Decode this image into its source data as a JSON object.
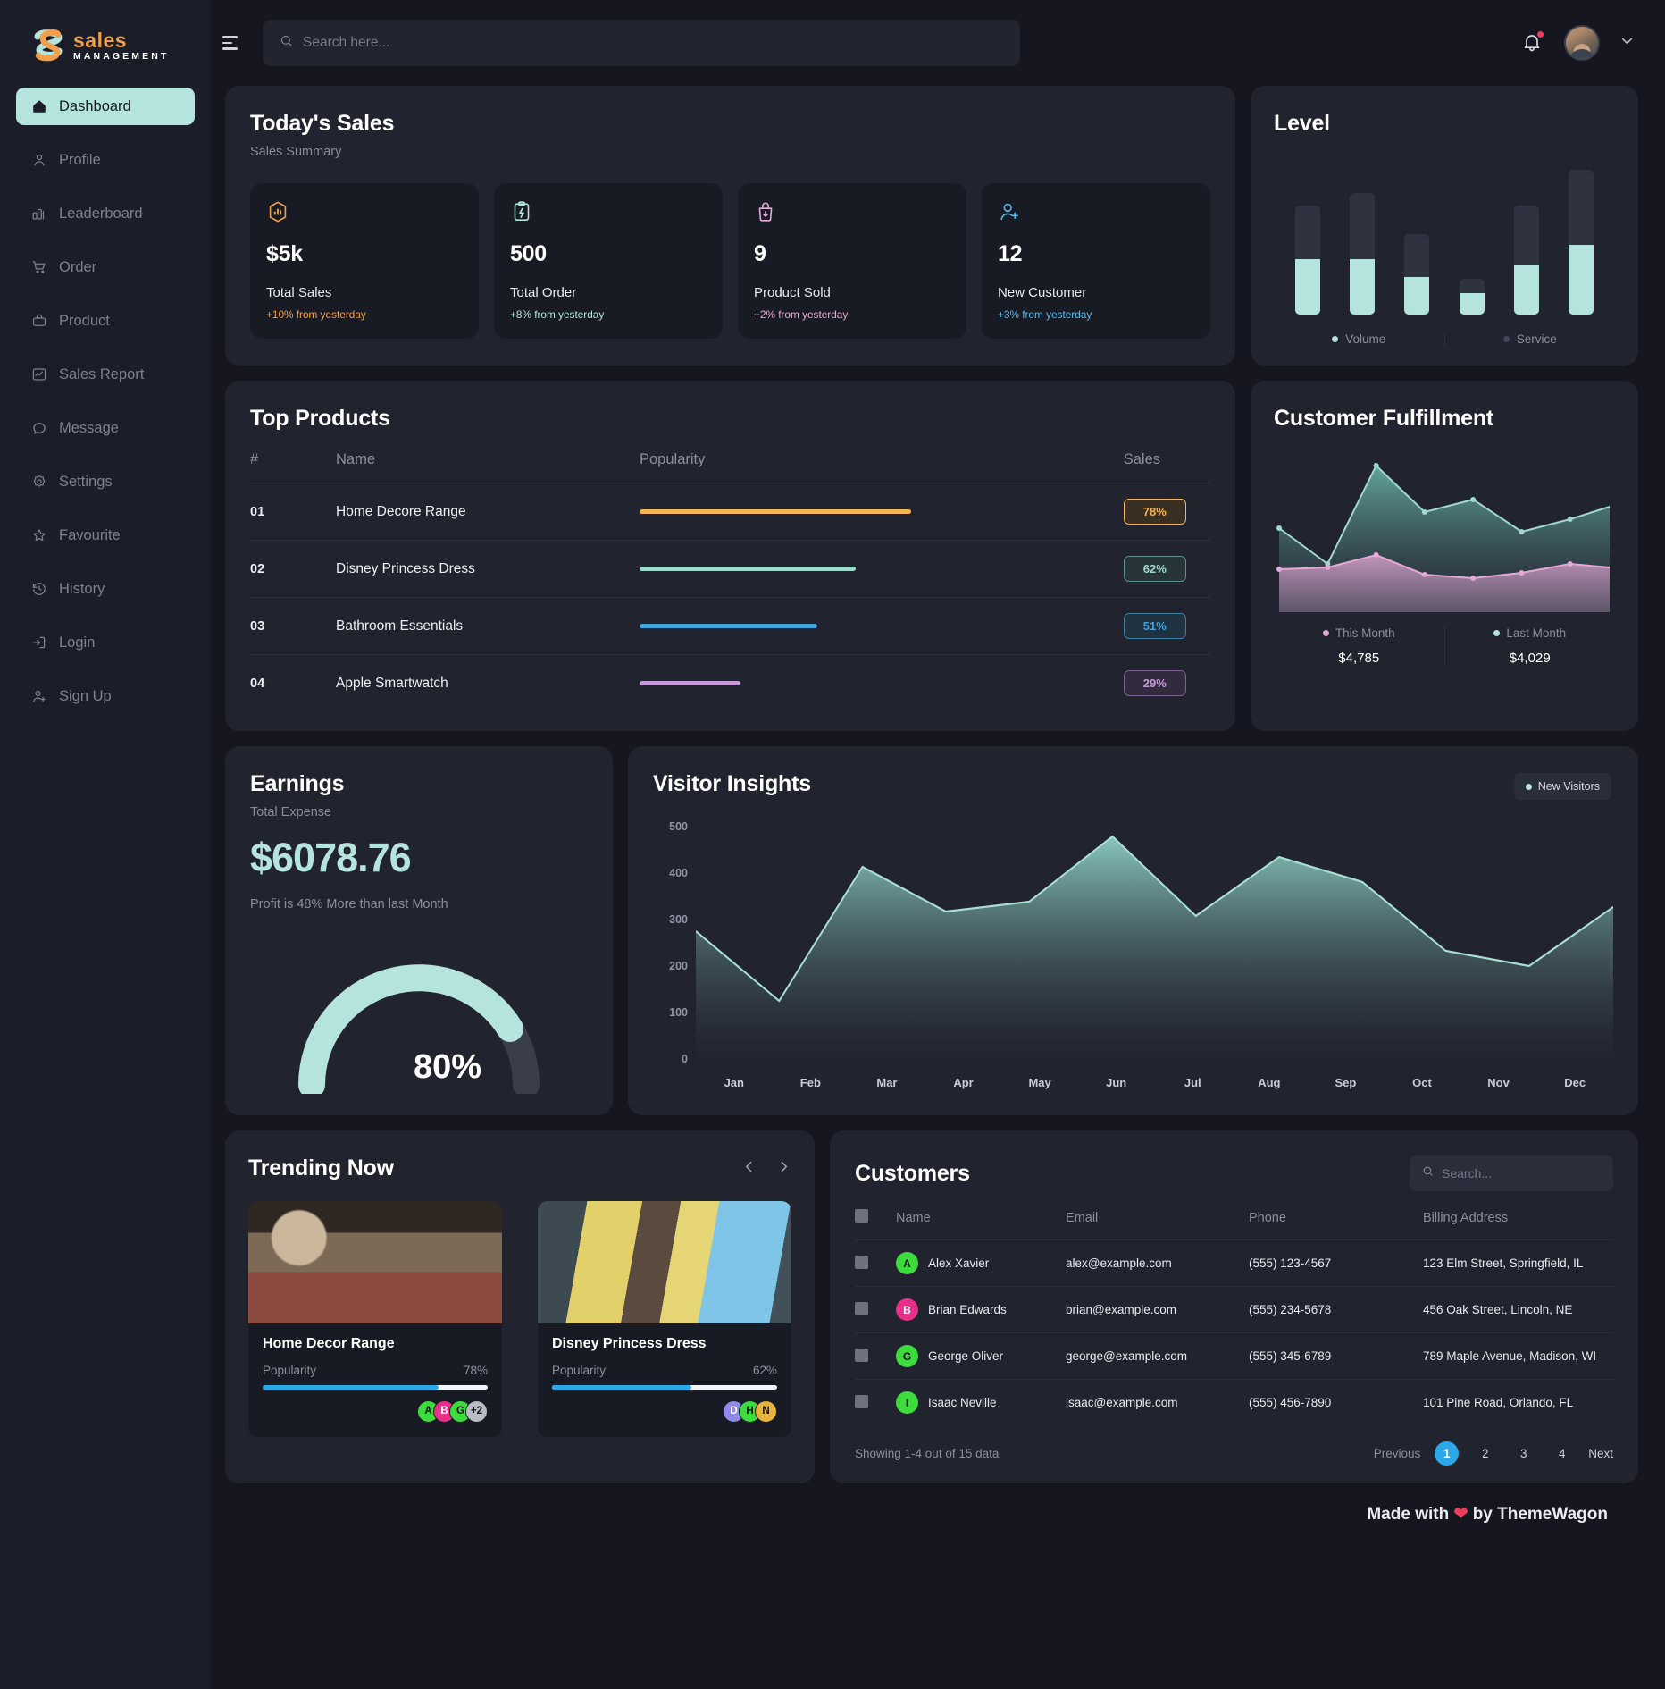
{
  "brand": {
    "line1": "sales",
    "line2": "MANAGEMENT"
  },
  "sidebar": {
    "items": [
      {
        "label": "Dashboard",
        "icon": "home-icon",
        "active": true
      },
      {
        "label": "Profile",
        "icon": "user-icon",
        "active": false
      },
      {
        "label": "Leaderboard",
        "icon": "bar-chart-icon",
        "active": false
      },
      {
        "label": "Order",
        "icon": "cart-icon",
        "active": false
      },
      {
        "label": "Product",
        "icon": "bag-icon",
        "active": false
      },
      {
        "label": "Sales Report",
        "icon": "line-chart-icon",
        "active": false
      },
      {
        "label": "Message",
        "icon": "chat-icon",
        "active": false
      },
      {
        "label": "Settings",
        "icon": "gear-icon",
        "active": false
      },
      {
        "label": "Favourite",
        "icon": "star-icon",
        "active": false
      },
      {
        "label": "History",
        "icon": "history-icon",
        "active": false
      },
      {
        "label": "Login",
        "icon": "login-icon",
        "active": false
      },
      {
        "label": "Sign Up",
        "icon": "user-plus-icon",
        "active": false
      }
    ]
  },
  "topbar": {
    "search_placeholder": "Search here...",
    "notification_badge": true
  },
  "todays_sales": {
    "title": "Today's Sales",
    "subtitle": "Sales Summary",
    "stats": [
      {
        "value": "$5k",
        "label": "Total Sales",
        "change": "+10% from yesterday",
        "color": "#f0a04b",
        "icon": "chart-hexagon-icon"
      },
      {
        "value": "500",
        "label": "Total Order",
        "change": "+8% from yesterday",
        "color": "#b5e3dd",
        "icon": "clipboard-bolt-icon"
      },
      {
        "value": "9",
        "label": "Product Sold",
        "change": "+2% from yesterday",
        "color": "#e6a8d6",
        "icon": "bag-down-icon"
      },
      {
        "value": "12",
        "label": "New Customer",
        "change": "+3% from yesterday",
        "color": "#5ab9e8",
        "icon": "user-add-icon"
      }
    ]
  },
  "level": {
    "title": "Level",
    "legend": [
      {
        "label": "Volume",
        "color": "#b5e3dd"
      },
      {
        "label": "Service",
        "color": "#2f3340"
      }
    ],
    "chart_data": {
      "type": "bar",
      "title": "Level",
      "categories": [
        "1",
        "2",
        "3",
        "4",
        "5",
        "6"
      ],
      "series": [
        {
          "name": "Service",
          "values": [
            60,
            74,
            48,
            16,
            66,
            84
          ]
        },
        {
          "name": "Volume",
          "values": [
            62,
            62,
            42,
            24,
            56,
            78
          ]
        }
      ],
      "ylim": [
        0,
        150
      ],
      "grid": false,
      "legend_position": "bottom"
    }
  },
  "top_products": {
    "title": "Top Products",
    "columns": [
      "#",
      "Name",
      "Popularity",
      "Sales"
    ],
    "rows": [
      {
        "num": "01",
        "name": "Home Decore Range",
        "popularity": 78,
        "sales": "78%",
        "color": "#f5b553"
      },
      {
        "num": "02",
        "name": "Disney Princess Dress",
        "popularity": 62,
        "sales": "62%",
        "color": "#9fd8cd"
      },
      {
        "num": "03",
        "name": "Bathroom Essentials",
        "popularity": 51,
        "sales": "51%",
        "color": "#3ea5e0"
      },
      {
        "num": "04",
        "name": "Apple Smartwatch",
        "popularity": 29,
        "sales": "29%",
        "color": "#c39ad6"
      }
    ]
  },
  "customer_fulfillment": {
    "title": "Customer Fulfillment",
    "footer": [
      {
        "label": "This Month",
        "value": "$4,785",
        "color": "#e6a8d6"
      },
      {
        "label": "Last Month",
        "value": "$4,029",
        "color": "#b5e3dd"
      }
    ],
    "chart_data": {
      "type": "area",
      "title": "Customer Fulfillment",
      "x": [
        "1",
        "2",
        "3",
        "4",
        "5",
        "6",
        "7",
        "8"
      ],
      "series": [
        {
          "name": "Last Month",
          "color": "#b5e3dd",
          "values": [
            52,
            30,
            95,
            60,
            70,
            48,
            58,
            62
          ]
        },
        {
          "name": "This Month",
          "color": "#e6a8d6",
          "values": [
            22,
            24,
            36,
            20,
            18,
            22,
            26,
            24
          ]
        }
      ],
      "grid": false,
      "legend_position": "bottom"
    }
  },
  "earnings": {
    "title": "Earnings",
    "subtitle": "Total Expense",
    "amount": "$6078.76",
    "note": "Profit is 48% More than last Month",
    "gauge_percent": "80%",
    "chart_data": {
      "type": "pie",
      "title": "Earnings gauge",
      "categories": [
        "Achieved",
        "Remaining"
      ],
      "values": [
        80,
        20
      ],
      "ylabel": "%"
    }
  },
  "visitor_insights": {
    "title": "Visitor Insights",
    "legend_label": "New Visitors",
    "chart_data": {
      "type": "area",
      "title": "Visitor Insights",
      "xlabel": "",
      "ylabel": "",
      "categories": [
        "Jan",
        "Feb",
        "Mar",
        "Apr",
        "May",
        "Jun",
        "Jul",
        "Aug",
        "Sep",
        "Oct",
        "Nov",
        "Dec"
      ],
      "values": [
        270,
        130,
        400,
        310,
        330,
        480,
        300,
        420,
        370,
        230,
        200,
        320
      ],
      "ylim": [
        0,
        500
      ],
      "yticks": [
        0,
        100,
        200,
        300,
        400,
        500
      ],
      "grid": false,
      "legend_position": "top-right"
    }
  },
  "trending": {
    "title": "Trending Now",
    "cards": [
      {
        "name": "Home Decor Range",
        "meta_label": "Popularity",
        "percent": "78%",
        "progress": 78,
        "faces": [
          {
            "t": "A",
            "c": "#3ddc3d"
          },
          {
            "t": "B",
            "c": "#e8308a"
          },
          {
            "t": "G",
            "c": "#3ddc3d"
          },
          {
            "t": "+2",
            "c": "#b9bcc4"
          }
        ],
        "image": "living-room-photo"
      },
      {
        "name": "Disney Princess Dress",
        "meta_label": "Popularity",
        "percent": "62%",
        "progress": 62,
        "faces": [
          {
            "t": "D",
            "c": "#8f8ae8"
          },
          {
            "t": "H",
            "c": "#3ddc3d"
          },
          {
            "t": "N",
            "c": "#e8b33d"
          }
        ],
        "image": "princess-dress-photo"
      }
    ]
  },
  "customers": {
    "title": "Customers",
    "search_placeholder": "Search...",
    "columns": [
      "Name",
      "Email",
      "Phone",
      "Billing Address"
    ],
    "rows": [
      {
        "initial": "A",
        "color": "#3ddc3d",
        "name": "Alex Xavier",
        "email": "alex@example.com",
        "phone": "(555) 123-4567",
        "address": "123 Elm Street, Springfield, IL"
      },
      {
        "initial": "B",
        "color": "#e8308a",
        "name": "Brian Edwards",
        "email": "brian@example.com",
        "phone": "(555) 234-5678",
        "address": "456 Oak Street, Lincoln, NE"
      },
      {
        "initial": "G",
        "color": "#3ddc3d",
        "name": "George Oliver",
        "email": "george@example.com",
        "phone": "(555) 345-6789",
        "address": "789 Maple Avenue, Madison, WI"
      },
      {
        "initial": "I",
        "color": "#3ddc3d",
        "name": "Isaac Neville",
        "email": "isaac@example.com",
        "phone": "(555) 456-7890",
        "address": "101 Pine Road, Orlando, FL"
      }
    ],
    "showing": "Showing 1-4 out of 15 data",
    "pagination": {
      "prev": "Previous",
      "pages": [
        "1",
        "2",
        "3",
        "4"
      ],
      "current": "1",
      "next": "Next"
    }
  },
  "footer": {
    "made_prefix": "Made with",
    "made_suffix": "by ThemeWagon"
  }
}
